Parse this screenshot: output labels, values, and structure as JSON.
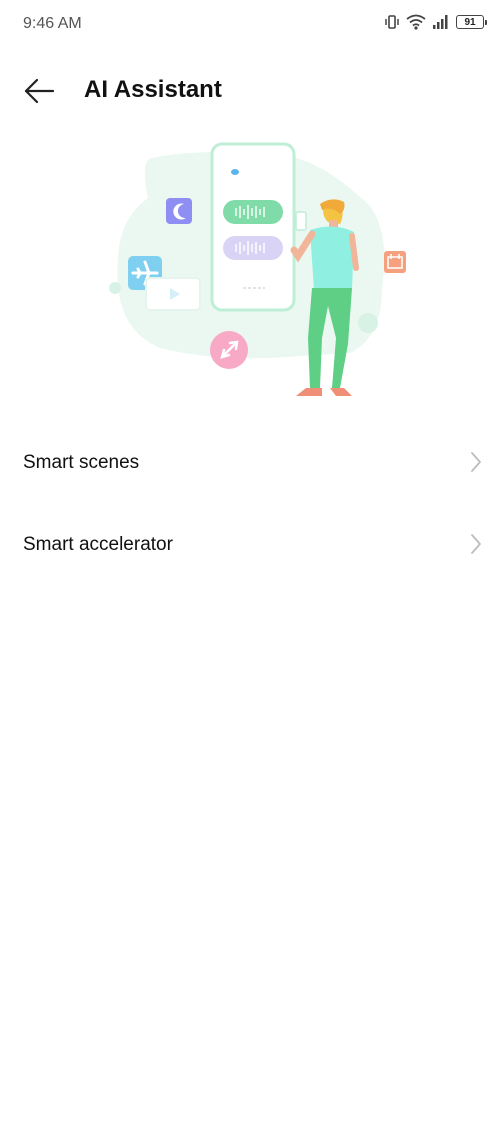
{
  "status_bar": {
    "time": "9:46 AM",
    "icons": [
      "vibrate-icon",
      "wifi-icon",
      "signal-icon",
      "battery-icon"
    ],
    "battery_level": "91"
  },
  "header": {
    "title": "AI Assistant",
    "back_icon": "arrow-left-icon"
  },
  "illustration": {
    "name": "ai-assistant-illustration",
    "accent_colors": [
      "#7be5b3",
      "#a9e7f3",
      "#8f8ef3",
      "#f7a9c6",
      "#f5a07f",
      "#5fcf85",
      "#f5c342"
    ]
  },
  "menu": {
    "items": [
      {
        "label": "Smart scenes",
        "icon": "chevron-right-icon"
      },
      {
        "label": "Smart accelerator",
        "icon": "chevron-right-icon"
      }
    ]
  },
  "colors": {
    "text_primary": "#111111",
    "text_secondary": "#555555",
    "chevron": "#bdbdbd",
    "background": "#ffffff"
  }
}
